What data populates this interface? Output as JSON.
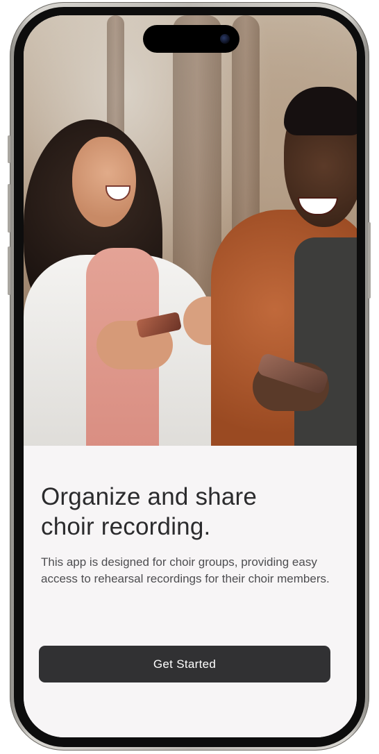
{
  "onboarding": {
    "headline_line1": "Organize and share",
    "headline_line2": "choir recording.",
    "description": "This app is designed for choir groups, providing easy access to rehearsal recordings for their choir members.",
    "cta_label": "Get Started"
  },
  "colors": {
    "background": "#f7f5f6",
    "headline": "#2b2b2d",
    "body_text": "#4d4d50",
    "button_bg": "#313133",
    "button_text": "#ffffff"
  }
}
